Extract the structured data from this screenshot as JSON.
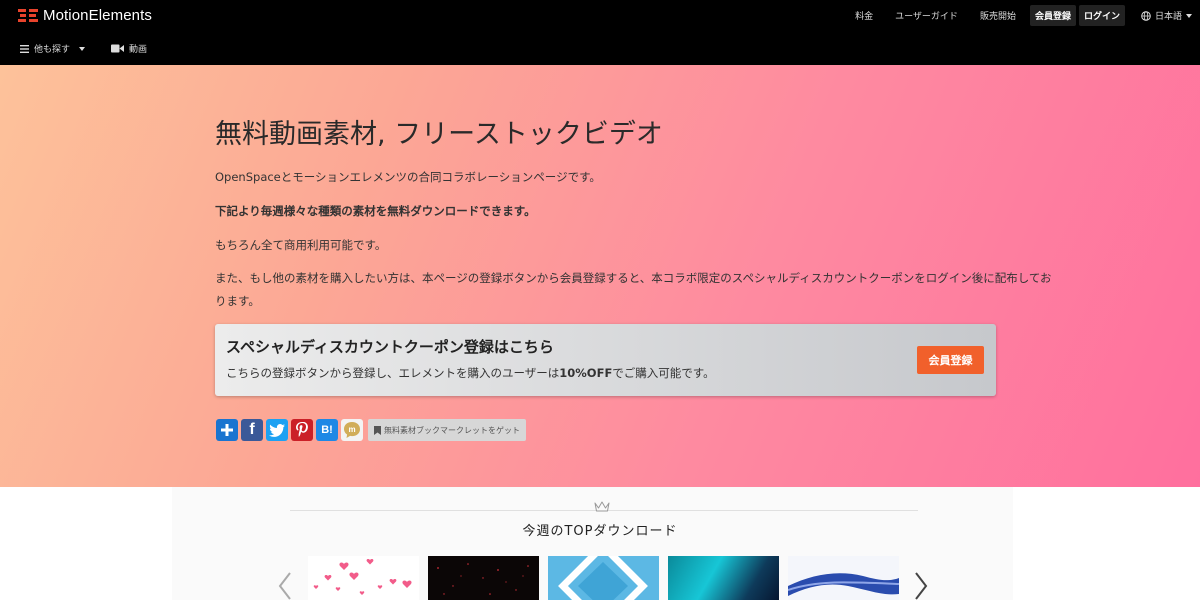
{
  "header": {
    "brand": "MotionElements",
    "nav": [
      {
        "label": "料金"
      },
      {
        "label": "ユーザーガイド"
      },
      {
        "label": "販売開始"
      }
    ],
    "signup_label": "会員登録",
    "login_label": "ログイン",
    "language_label": "日本語",
    "menu_label": "他も探す",
    "video_label": "動画"
  },
  "hero": {
    "title": "無料動画素材, フリーストックビデオ",
    "paragraphs": [
      "OpenSpaceとモーションエレメンツの合同コラボレーションページです。",
      "下記より毎週様々な種類の素材を無料ダウンロードできます。",
      "もちろん全て商用利用可能です。",
      "また、もし他の素材を購入したい方は、本ページの登録ボタンから会員登録すると、本コラボ限定のスペシャルディスカウントクーポンをログイン後に配布してお",
      "ります。"
    ]
  },
  "coupon": {
    "title": "スペシャルディスカウントクーポン登録はこちら",
    "desc_before": "こちらの登録ボタンから登録し、エレメントを購入のユーザーは",
    "desc_highlight": "10%OFF",
    "desc_after": "でご購入可能です。",
    "button_label": "会員登録"
  },
  "share": {
    "buttons": [
      {
        "name": "add",
        "glyph": "+",
        "color": "#1a74d0"
      },
      {
        "name": "facebook",
        "glyph": "f",
        "color": "#3b5998"
      },
      {
        "name": "twitter",
        "glyph": "t",
        "color": "#1da1f2"
      },
      {
        "name": "pinterest",
        "glyph": "P",
        "color": "#cb2027"
      },
      {
        "name": "hatena",
        "glyph": "B!",
        "color": "#1e88e5"
      },
      {
        "name": "mixi",
        "glyph": "m",
        "color": "#d1ad59"
      }
    ],
    "bookmarklet_label": "無料素材ブックマークレットをゲット"
  },
  "top_downloads": {
    "title": "今週のTOPダウンロード",
    "thumbnails": [
      {
        "name": "hearts"
      },
      {
        "name": "particles-dark"
      },
      {
        "name": "blue-diamond"
      },
      {
        "name": "aurora"
      },
      {
        "name": "blue-wave"
      }
    ]
  },
  "colors": {
    "brand_orange": "#f1602b",
    "topbar": "#000000"
  }
}
